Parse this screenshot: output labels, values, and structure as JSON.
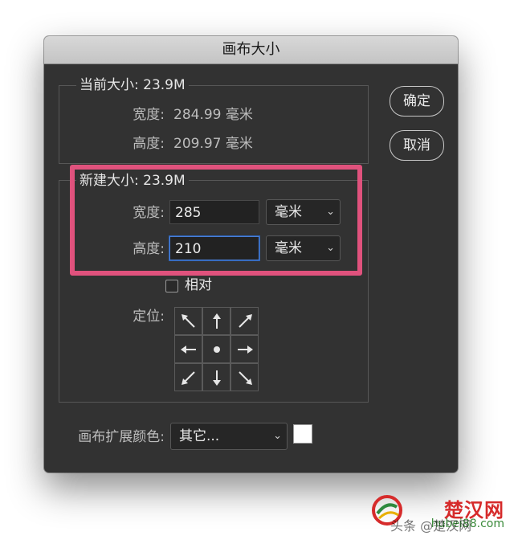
{
  "dialog": {
    "title": "画布大小",
    "ok_label": "确定",
    "cancel_label": "取消"
  },
  "current_size": {
    "label": "当前大小: 23.9M",
    "width_label": "宽度:",
    "width_value": "284.99 毫米",
    "height_label": "高度:",
    "height_value": "209.97 毫米"
  },
  "new_size": {
    "label": "新建大小: 23.9M",
    "width_label": "宽度:",
    "width_value": "285",
    "width_unit": "毫米",
    "height_label": "高度:",
    "height_value": "210",
    "height_unit": "毫米",
    "relative_label": "相对",
    "relative_checked": false,
    "anchor_label": "定位:"
  },
  "extension": {
    "label": "画布扩展颜色:",
    "value": "其它...",
    "swatch_color": "#ffffff"
  },
  "colors": {
    "dialog_bg": "#323232",
    "highlight": "#e0527d",
    "focus": "#4a7fd6"
  },
  "watermark": {
    "brand": "楚汉网",
    "domain": "hubei88.com",
    "overlay": "头条 @楚汉网"
  }
}
